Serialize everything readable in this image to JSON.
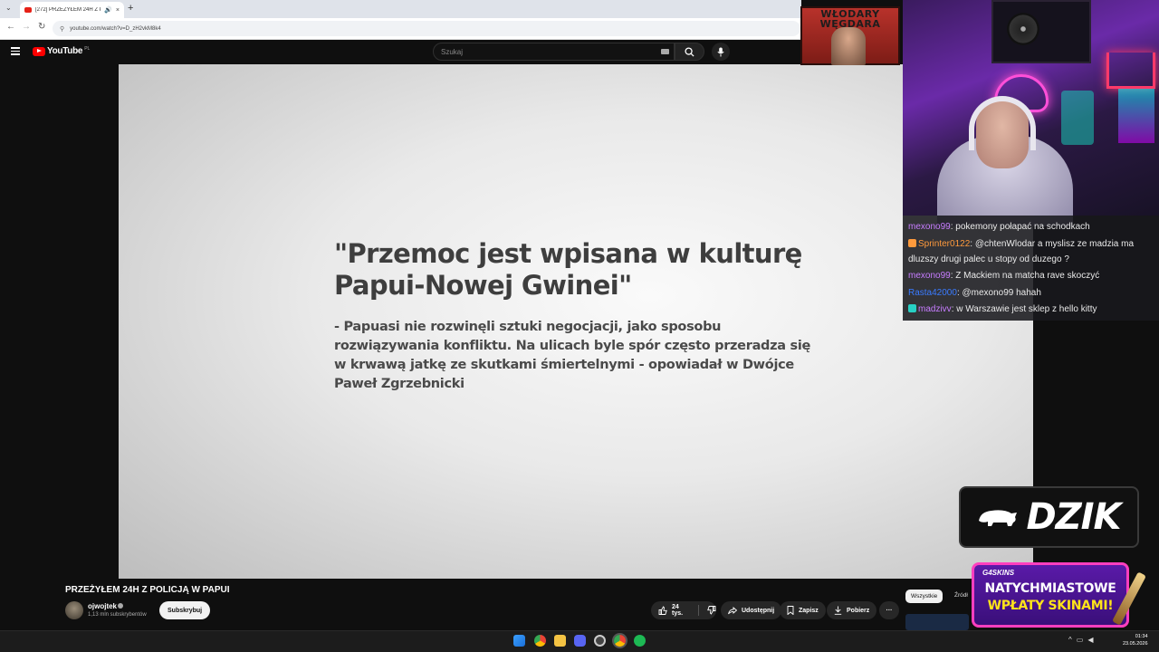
{
  "browser": {
    "tab_title": "[272] PRZEŻYŁEM 24H Z POLICJĄ W PAPUI",
    "new_tab": "+",
    "close_tab": "×",
    "url": "youtube.com/watch?v=D_zH2vkM8k4"
  },
  "youtube": {
    "logo_text": "YouTube",
    "logo_region": "PL",
    "search_placeholder": "Szukaj"
  },
  "video": {
    "quote_title": "\"Przemoc jest wpisana w kulturę Papui-Nowej Gwinei\"",
    "quote_body": "- Papuasi nie rozwinęli sztuki negocjacji, jako sposobu rozwiązywania konfliktu. Na ulicach byle spór często przeradza się w krwawą jatkę ze skutkami śmiertelnymi - opowiadał w Dwójce Paweł Zgrzebnicki",
    "title": "PRZEŻYŁEM 24H Z POLICJĄ W PAPUI",
    "channel_name": "ojwojtek",
    "subscribers": "1,13 mln subskrybentów",
    "subscribe_label": "Subskrybuj",
    "likes": "24 tys.",
    "share_label": "Udostępnij",
    "save_label": "Zapisz",
    "download_label": "Pobierz",
    "more_label": "···",
    "filter_all": "Wszystkie",
    "filter_source": "Źródł"
  },
  "overlay": {
    "badge_text": "WŁODARY WĘGDARA",
    "chat": [
      {
        "user": "mexono99",
        "user_color": "#c77dff",
        "message": ": pokemony połapać na schodkach",
        "badge_color": ""
      },
      {
        "user": "Sprinter0122",
        "user_color": "#ff9a3c",
        "message": ": @chtenWlodar a myslisz ze madzia ma dluzszy drugi palec u stopy od duzego ?",
        "badge_color": "#ff9a3c"
      },
      {
        "user": "mexono99",
        "user_color": "#c77dff",
        "message": ": Z Mackiem na matcha rave skoczyć",
        "badge_color": ""
      },
      {
        "user": "Rasta42000",
        "user_color": "#3a7bff",
        "message": ": @mexono99 hahah",
        "badge_color": ""
      },
      {
        "user": "madzivv",
        "user_color": "#c77dff",
        "message": ": w Warszawie jest sklep z hello kitty",
        "badge_color": "#27d0c4"
      }
    ],
    "chat_line2_wrap": "dluzszy drugi palec u stopy od duzego ?",
    "dzik_wordmark": "DZIK",
    "promo_brand": "G4SKINS",
    "promo_line1": "NATYCHMIASTOWE",
    "promo_line2": "WPŁATY SKINAMI!"
  },
  "taskbar": {
    "time": "01:34",
    "date": "23.05.2026"
  }
}
